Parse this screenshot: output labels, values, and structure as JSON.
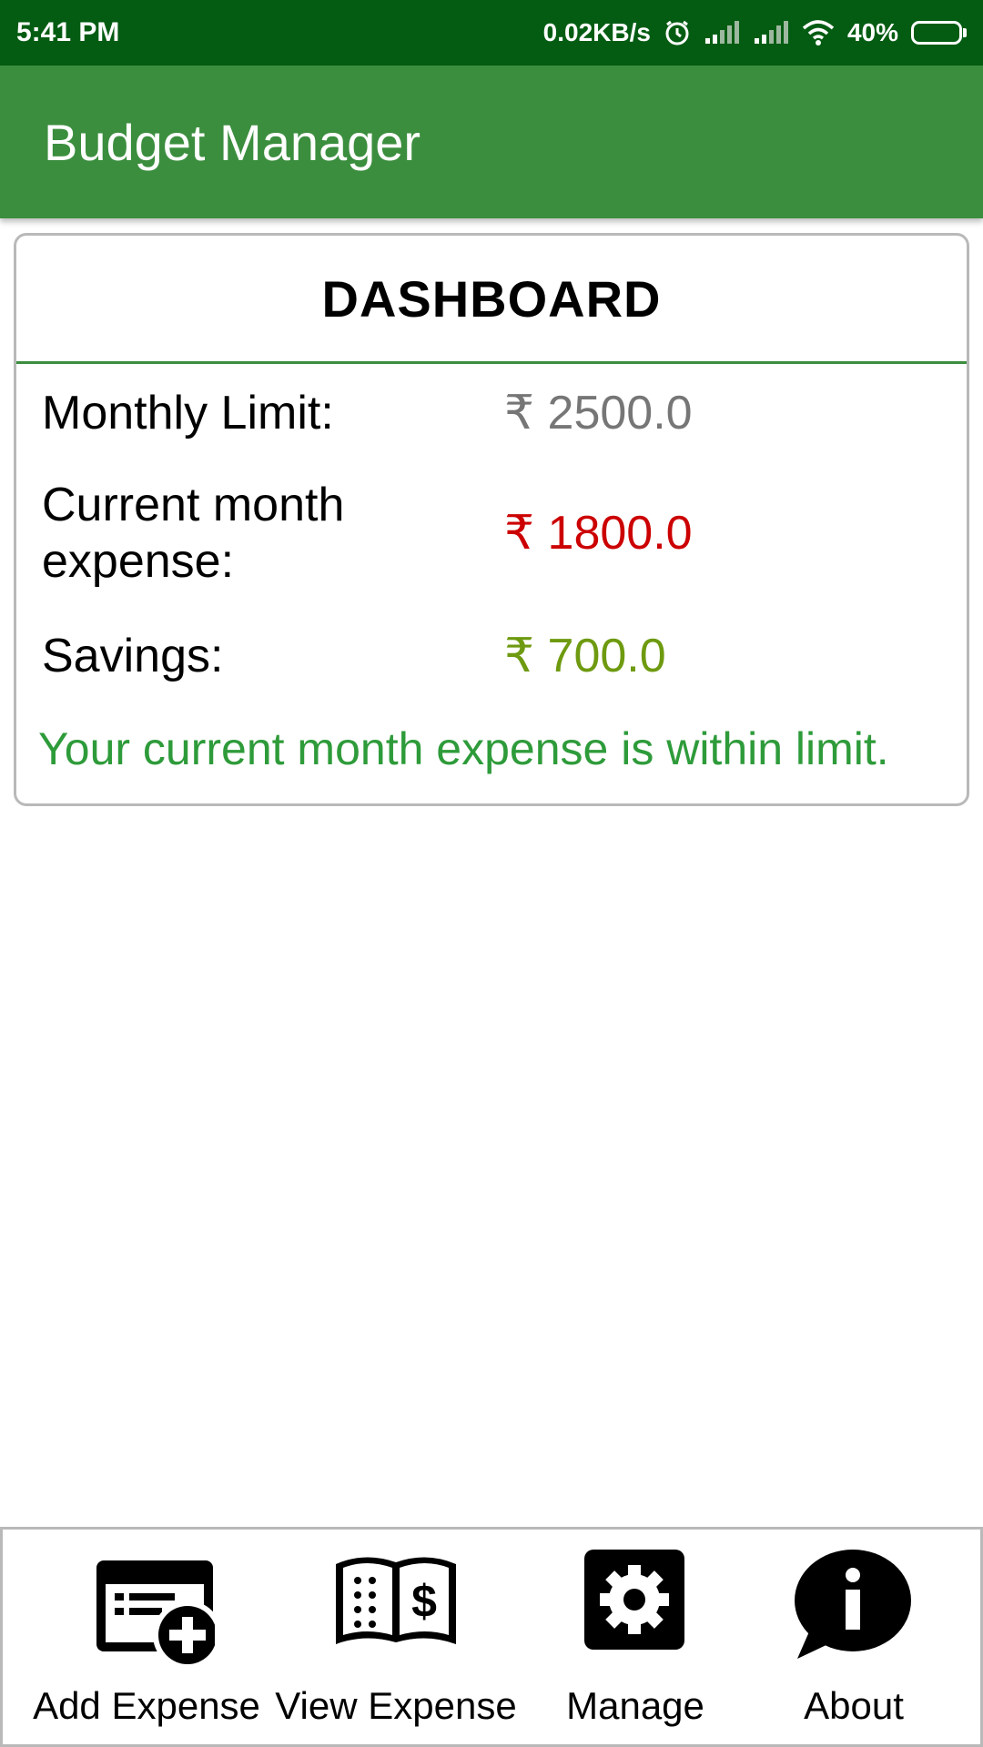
{
  "status_bar": {
    "time": "5:41 PM",
    "network_speed": "0.02KB/s",
    "battery": "40%",
    "battery_level": 0.4
  },
  "app_bar": {
    "title": "Budget Manager"
  },
  "dashboard": {
    "title": "DASHBOARD",
    "rows": [
      {
        "label": "Monthly Limit:",
        "value": "₹ 2500.0"
      },
      {
        "label": "Current month expense:",
        "value": "₹ 1800.0"
      },
      {
        "label": "Savings:",
        "value": "₹ 700.0"
      }
    ],
    "message": "Your current month expense is within limit.",
    "colors": {
      "limit": "#767676",
      "expense": "#cc0000",
      "savings": "#6e9a10",
      "message": "#2e9b3a"
    }
  },
  "bottom_nav": {
    "items": [
      {
        "label": "Add Expense",
        "icon": "add-expense-icon"
      },
      {
        "label": "View Expense",
        "icon": "view-expense-icon"
      },
      {
        "label": "Manage",
        "icon": "gear-icon"
      },
      {
        "label": "About",
        "icon": "info-icon"
      }
    ]
  },
  "colors": {
    "status_bar": "#035c12",
    "app_bar": "#3b8e3e",
    "divider": "#3b8e3e"
  }
}
